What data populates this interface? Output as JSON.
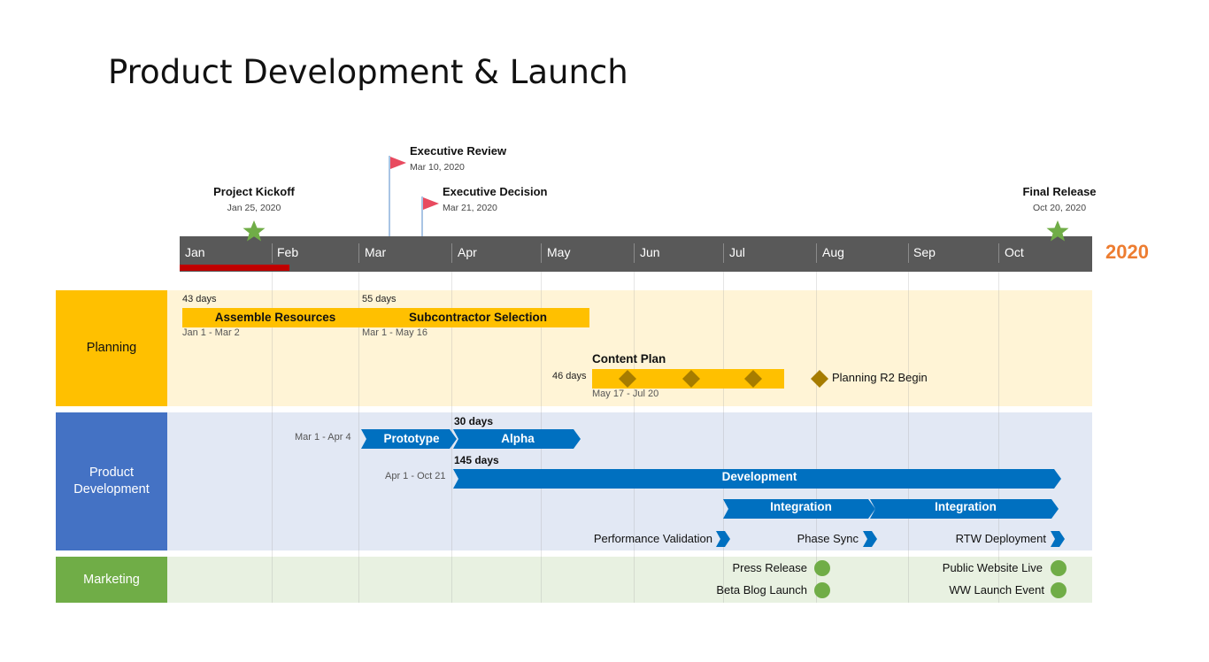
{
  "title": "Product Development & Launch",
  "year": "2020",
  "months": [
    "Jan",
    "Feb",
    "Mar",
    "Apr",
    "May",
    "Jun",
    "Jul",
    "Aug",
    "Sep",
    "Oct"
  ],
  "milestones": [
    {
      "name": "Executive Review",
      "date": "Mar 10, 2020",
      "marker": "flag-icon"
    },
    {
      "name": "Project Kickoff",
      "date": "Jan 25, 2020",
      "marker": "star-icon"
    },
    {
      "name": "Executive Decision",
      "date": "Mar 21, 2020",
      "marker": "flag-icon"
    },
    {
      "name": "Final Release",
      "date": "Oct 20, 2020",
      "marker": "star-icon"
    }
  ],
  "lanes": {
    "planning": {
      "label": "Planning",
      "tasks": [
        {
          "name": "Assemble Resources",
          "duration": "43 days",
          "dates": "Jan 1 - Mar 2"
        },
        {
          "name": "Subcontractor Selection",
          "duration": "55 days",
          "dates": "Mar 1 - May 16"
        },
        {
          "name": "Content Plan",
          "duration": "46 days",
          "dates": "May 17 - Jul 20"
        }
      ],
      "milestone": "Planning R2 Begin"
    },
    "product_development": {
      "label": "Product Development",
      "tasks": [
        {
          "name": "Prototype",
          "dates": "Mar 1 - Apr 4"
        },
        {
          "name": "Alpha",
          "duration": "30 days"
        },
        {
          "name": "Development",
          "duration": "145 days",
          "dates": "Apr 1 - Oct 21"
        },
        {
          "name": "Integration"
        },
        {
          "name": "Integration"
        }
      ],
      "milestones": [
        "Performance Validation",
        "Phase Sync",
        "RTW Deployment"
      ]
    },
    "marketing": {
      "label": "Marketing",
      "milestones": [
        "Press Release",
        "Beta Blog Launch",
        "Public Website Live",
        "WW Launch Event"
      ]
    }
  },
  "colors": {
    "axis": "#595959",
    "year": "#ED7D31",
    "today": "#C00000",
    "planning": "#FFC000",
    "planning_band": "#FFF4D6",
    "product_dev": "#4472C4",
    "product_dev_band": "#E2E8F4",
    "chevron": "#0070C0",
    "marketing": "#70AD47",
    "marketing_band": "#E8F1E1",
    "diamond": "#A67C00",
    "flag": "#E84A5F",
    "star": "#70AD47"
  }
}
